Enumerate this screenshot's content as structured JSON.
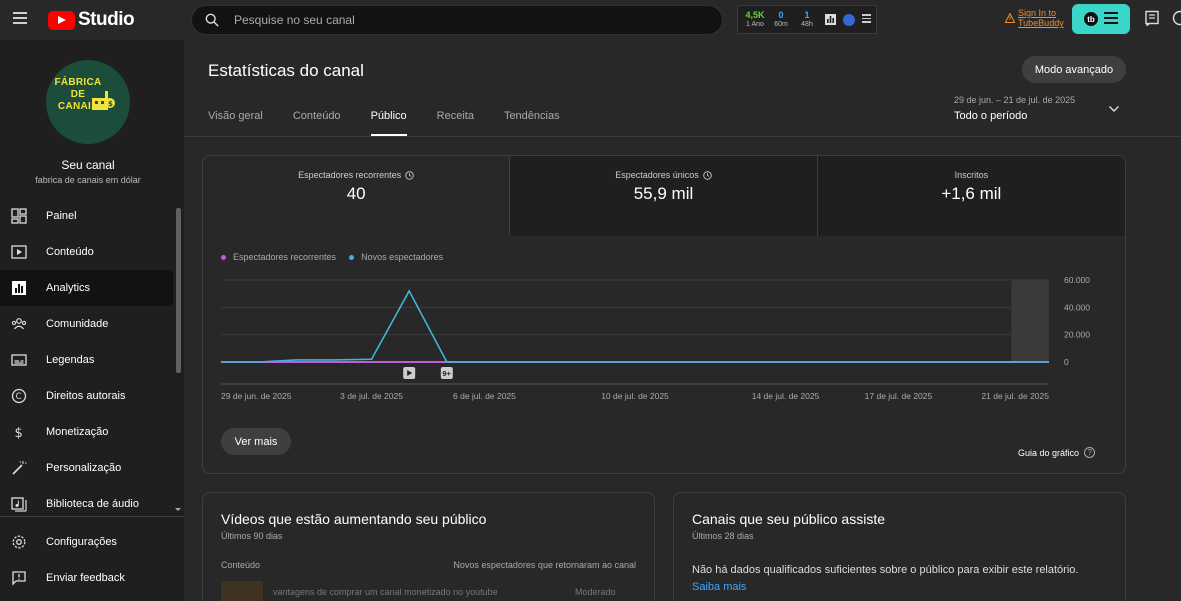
{
  "header": {
    "logo_text": "Studio",
    "search_placeholder": "Pesquise no seu canal",
    "tubebuddy": {
      "stats": [
        {
          "value": "4,5K",
          "label": "1 Ano",
          "color": "#6ccf46"
        },
        {
          "value": "0",
          "label": "60m",
          "color": "#3ea6ff"
        },
        {
          "value": "1",
          "label": "48h",
          "color": "#3ea6ff"
        }
      ],
      "signin_line1": "Sign In to",
      "signin_line2": "TubeBuddy"
    }
  },
  "sidebar": {
    "avatar_line1": "FÁBRICA",
    "avatar_line2": "DE",
    "avatar_line3": "CANAIS",
    "channel_name": "Seu canal",
    "channel_handle": "fabrica de canais em dólar",
    "items": [
      {
        "label": "Painel",
        "icon": "dashboard-icon"
      },
      {
        "label": "Conteúdo",
        "icon": "content-icon"
      },
      {
        "label": "Analytics",
        "icon": "analytics-icon"
      },
      {
        "label": "Comunidade",
        "icon": "community-icon"
      },
      {
        "label": "Legendas",
        "icon": "subtitles-icon"
      },
      {
        "label": "Direitos autorais",
        "icon": "copyright-icon"
      },
      {
        "label": "Monetização",
        "icon": "dollar-icon"
      },
      {
        "label": "Personalização",
        "icon": "magic-wand-icon"
      },
      {
        "label": "Biblioteca de áudio",
        "icon": "audio-library-icon"
      }
    ],
    "bottom_items": [
      {
        "label": "Configurações",
        "icon": "gear-icon"
      },
      {
        "label": "Enviar feedback",
        "icon": "feedback-icon"
      }
    ]
  },
  "main": {
    "title": "Estatísticas do canal",
    "advanced_button": "Modo avançado",
    "tabs": [
      {
        "label": "Visão geral"
      },
      {
        "label": "Conteúdo"
      },
      {
        "label": "Público"
      },
      {
        "label": "Receita"
      },
      {
        "label": "Tendências"
      }
    ],
    "active_tab": "Público",
    "date_range": "29 de jun. – 21 de jul. de 2025",
    "period": "Todo o período",
    "metrics": [
      {
        "title": "Espectadores recorrentes",
        "value": "40"
      },
      {
        "title": "Espectadores únicos",
        "value": "55,9 mil"
      },
      {
        "title": "Inscritos",
        "value": "+1,6 mil"
      }
    ],
    "see_more": "Ver mais",
    "chart_guide": "Guia do gráfico",
    "chart_data": {
      "type": "line",
      "x": [
        "29 de jun. de 2025",
        "30 de jun.",
        "1 de jul.",
        "2 de jul.",
        "3 de jul.",
        "4 de jul.",
        "5 de jul.",
        "6 de jul.",
        "7 de jul.",
        "8 de jul.",
        "9 de jul.",
        "10 de jul.",
        "11 de jul.",
        "12 de jul.",
        "13 de jul.",
        "14 de jul.",
        "15 de jul.",
        "16 de jul.",
        "17 de jul.",
        "18 de jul.",
        "19 de jul.",
        "20 de jul.",
        "21 de jul."
      ],
      "series": [
        {
          "name": "Espectadores recorrentes",
          "color": "#c05bdd",
          "values": [
            0,
            0,
            0,
            0,
            0,
            0,
            0,
            0,
            0,
            0,
            0,
            0,
            0,
            0,
            0,
            0,
            0,
            0,
            0,
            0,
            0,
            0,
            0
          ]
        },
        {
          "name": "Novos espectadores",
          "color": "#3fb6d8",
          "values": [
            0,
            0,
            1500,
            1500,
            2000,
            52000,
            0,
            0,
            0,
            0,
            0,
            0,
            0,
            0,
            0,
            0,
            0,
            0,
            0,
            0,
            0,
            0,
            0
          ]
        }
      ],
      "x_tick_labels": [
        {
          "label": "29 de jun. de 2025",
          "index": 0
        },
        {
          "label": "3 de jul. de 2025",
          "index": 4
        },
        {
          "label": "6 de jul. de 2025",
          "index": 7
        },
        {
          "label": "10 de jul. de 2025",
          "index": 11
        },
        {
          "label": "14 de jul. de 2025",
          "index": 15
        },
        {
          "label": "17 de jul. de 2025",
          "index": 18
        },
        {
          "label": "21 de jul. de 2025",
          "index": 22
        }
      ],
      "y_ticks": [
        "0",
        "20.000",
        "40.000",
        "60.000"
      ],
      "ylim": [
        0,
        60000
      ],
      "markers": [
        {
          "index": 5,
          "icon": "video-icon"
        },
        {
          "index": 6,
          "badge": "9+"
        }
      ],
      "shaded_from_index": 21,
      "legend": "top-left"
    }
  },
  "growing_videos": {
    "title": "Vídeos que estão aumentando seu público",
    "subtitle": "Últimos 90 dias",
    "col_content": "Conteúdo",
    "col_metric": "Novos espectadores que retornaram ao canal",
    "rows": [
      {
        "title": "vantagens de comprar um canal monetizado no youtube",
        "value": "Moderado"
      }
    ]
  },
  "channels_watched": {
    "title": "Canais que seu público assiste",
    "subtitle": "Últimos 28 dias",
    "message": "Não há dados qualificados suficientes sobre o público para exibir este relatório.",
    "learn_more": "Saiba mais"
  }
}
